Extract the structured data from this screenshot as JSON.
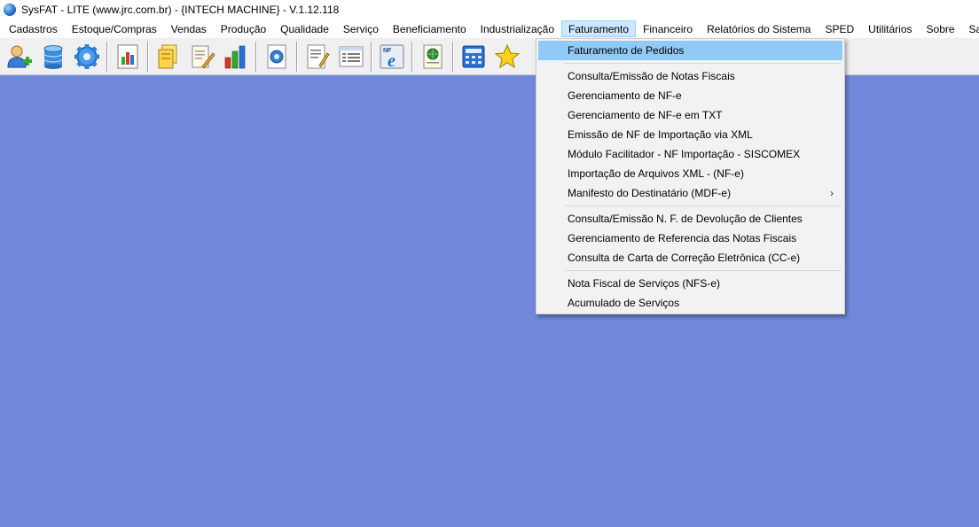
{
  "window": {
    "title": "SysFAT - LITE (www.jrc.com.br) - {INTECH MACHINE} - V.1.12.118"
  },
  "menubar": {
    "items": [
      {
        "label": "Cadastros"
      },
      {
        "label": "Estoque/Compras"
      },
      {
        "label": "Vendas"
      },
      {
        "label": "Produção"
      },
      {
        "label": "Qualidade"
      },
      {
        "label": "Serviço"
      },
      {
        "label": "Beneficiamento"
      },
      {
        "label": "Industrialização"
      },
      {
        "label": "Faturamento"
      },
      {
        "label": "Financeiro"
      },
      {
        "label": "Relatórios do Sistema"
      },
      {
        "label": "SPED"
      },
      {
        "label": "Utilitários"
      },
      {
        "label": "Sobre"
      },
      {
        "label": "Sair"
      }
    ],
    "open_menu": "Faturamento"
  },
  "toolbar": {
    "buttons": [
      {
        "icon": "add-user-icon"
      },
      {
        "icon": "database-icon"
      },
      {
        "icon": "gear-icon"
      },
      {
        "icon": "chart-document-icon"
      },
      {
        "icon": "folders-icon"
      },
      {
        "icon": "edit-document-icon"
      },
      {
        "icon": "bar-chart-icon"
      },
      {
        "icon": "gear-document-icon"
      },
      {
        "icon": "write-document-icon"
      },
      {
        "icon": "list-document-icon"
      },
      {
        "icon": "nfe-icon"
      },
      {
        "icon": "web-document-icon"
      },
      {
        "icon": "calculator-icon"
      },
      {
        "icon": "star-icon"
      }
    ]
  },
  "faturamento_menu": {
    "items": [
      "Faturamento de Pedidos",
      "Consulta/Emissão de Notas Fiscais",
      "Gerenciamento de NF-e",
      "Gerenciamento de NF-e em TXT",
      "Emissão de NF de Importação via XML",
      "Módulo Facilitador - NF Importação - SISCOMEX",
      "Importação de Arquivos XML - (NF-e)",
      "Manifesto do Destinatário (MDF-e)",
      "Consulta/Emissão N. F. de Devolução de Clientes",
      "Gerenciamento de Referencia das Notas Fiscais",
      "Consulta de Carta de Correção Eletrônica (CC-e)",
      "Nota Fiscal de Serviços (NFS-e)",
      "Acumulado de Serviços"
    ],
    "highlighted": "Faturamento de Pedidos",
    "submenu_arrow": "›"
  },
  "colors": {
    "workspace": "#6f88db",
    "menu_highlight": "#91c9f7",
    "menubar_open": "#cce8ff"
  }
}
